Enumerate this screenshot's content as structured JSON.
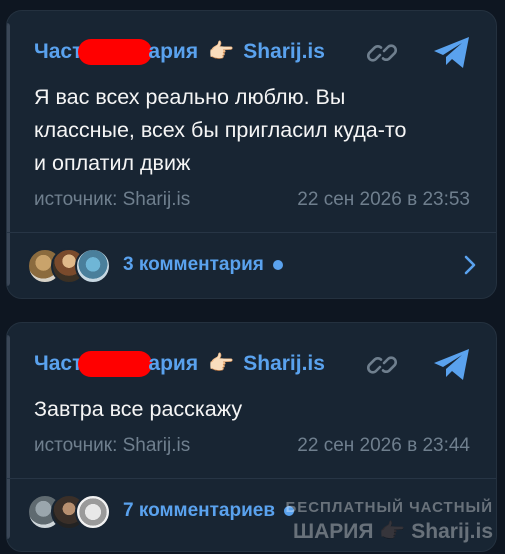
{
  "posts": [
    {
      "channel_prefix": "Част",
      "channel_suffix": "ария",
      "hand": "👉🏻",
      "channel_site": "Sharij.is",
      "message_lines": [
        "Я вас всех реально люблю. Вы",
        "классные, всех бы пригласил куда-то",
        "и оплатил движ"
      ],
      "source": "источник: Sharij.is",
      "date": "22 сен 2026 в 23:53",
      "comments_label": "3 комментария"
    },
    {
      "channel_prefix": "Част",
      "channel_suffix": "ария",
      "hand": "👉🏻",
      "channel_site": "Sharij.is",
      "message_lines": [
        "Завтра все расскажу"
      ],
      "source": "источник: Sharij.is",
      "date": "22 сен 2026 в 23:44",
      "comments_label": "7 комментариев"
    }
  ],
  "watermark": {
    "line1": "БЕСПЛАТНЫЙ ЧАСТНЫЙ",
    "line2_prefix": "ШАРИЯ",
    "hand": "👉🏿",
    "line2_site": "Sharij.is"
  },
  "colors": {
    "background": "#0e1621",
    "card": "#182533",
    "accent": "#5aa2ee",
    "redaction": "#ff0000"
  },
  "icons": [
    "link-icon",
    "telegram-icon",
    "chevron-right-icon"
  ]
}
